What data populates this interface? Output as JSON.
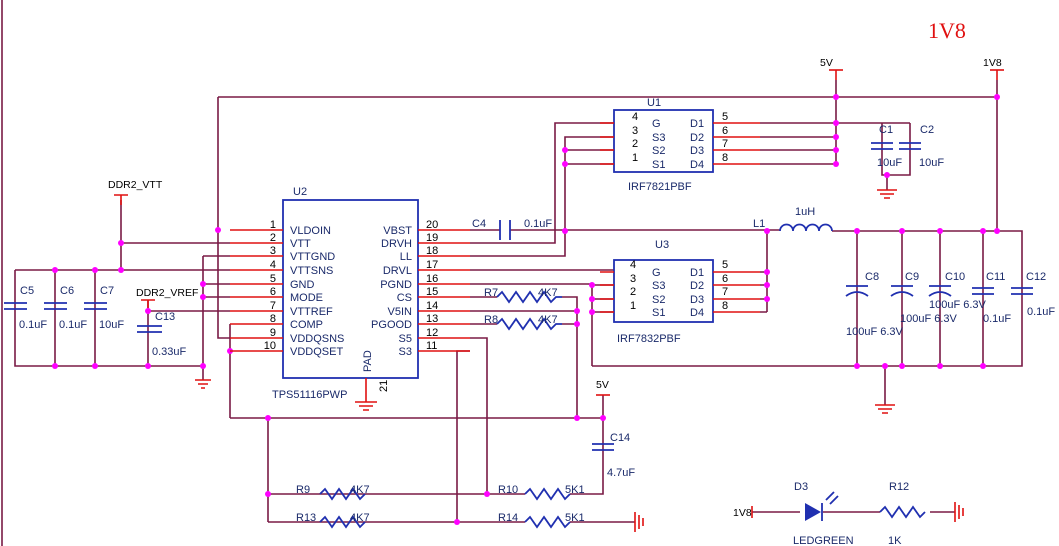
{
  "title": "1V8",
  "rails": {
    "v5": "5V",
    "v1v8": "1V8",
    "ddr2_vtt": "DDR2_VTT",
    "ddr2_vref": "DDR2_VREF"
  },
  "u2": {
    "ref": "U2",
    "part": "TPS51116PWP",
    "pad": "PAD",
    "pad_pin": "21",
    "left_pins": [
      {
        "num": "1",
        "name": "VLDOIN"
      },
      {
        "num": "2",
        "name": "VTT"
      },
      {
        "num": "3",
        "name": "VTTGND"
      },
      {
        "num": "4",
        "name": "VTTSNS"
      },
      {
        "num": "5",
        "name": "GND"
      },
      {
        "num": "6",
        "name": "MODE"
      },
      {
        "num": "7",
        "name": "VTTREF"
      },
      {
        "num": "8",
        "name": "COMP"
      },
      {
        "num": "9",
        "name": "VDDQSNS"
      },
      {
        "num": "10",
        "name": "VDDQSET"
      }
    ],
    "right_pins": [
      {
        "num": "20",
        "name": "VBST"
      },
      {
        "num": "19",
        "name": "DRVH"
      },
      {
        "num": "18",
        "name": "LL"
      },
      {
        "num": "17",
        "name": "DRVL"
      },
      {
        "num": "16",
        "name": "PGND"
      },
      {
        "num": "15",
        "name": "CS"
      },
      {
        "num": "14",
        "name": "V5IN"
      },
      {
        "num": "13",
        "name": "PGOOD"
      },
      {
        "num": "12",
        "name": "S5"
      },
      {
        "num": "11",
        "name": "S3"
      }
    ]
  },
  "u1": {
    "ref": "U1",
    "part": "IRF7821PBF",
    "left_pins": [
      {
        "num": "4",
        "name": "G"
      },
      {
        "num": "3",
        "name": "S3"
      },
      {
        "num": "2",
        "name": "S2"
      },
      {
        "num": "1",
        "name": "S1"
      }
    ],
    "right_pins": [
      {
        "num": "5",
        "name": "D1"
      },
      {
        "num": "6",
        "name": "D2"
      },
      {
        "num": "7",
        "name": "D3"
      },
      {
        "num": "8",
        "name": "D4"
      }
    ]
  },
  "u3": {
    "ref": "U3",
    "part": "IRF7832PBF",
    "left_pins": [
      {
        "num": "4",
        "name": "G"
      },
      {
        "num": "3",
        "name": "S3"
      },
      {
        "num": "2",
        "name": "S2"
      },
      {
        "num": "1",
        "name": "S1"
      }
    ],
    "right_pins": [
      {
        "num": "5",
        "name": "D1"
      },
      {
        "num": "6",
        "name": "D2"
      },
      {
        "num": "7",
        "name": "D3"
      },
      {
        "num": "8",
        "name": "D4"
      }
    ]
  },
  "caps": {
    "c1": {
      "ref": "C1",
      "value": "10uF"
    },
    "c2": {
      "ref": "C2",
      "value": "10uF"
    },
    "c4": {
      "ref": "C4",
      "value": "0.1uF"
    },
    "c5": {
      "ref": "C5",
      "value": "0.1uF"
    },
    "c6": {
      "ref": "C6",
      "value": "0.1uF"
    },
    "c7": {
      "ref": "C7",
      "value": "10uF"
    },
    "c8": {
      "ref": "C8",
      "value": "100uF 6.3V"
    },
    "c9": {
      "ref": "C9",
      "value": "100uF 6.3V"
    },
    "c10": {
      "ref": "C10",
      "value": "100uF 6.3V"
    },
    "c11": {
      "ref": "C11",
      "value": "0.1uF"
    },
    "c12": {
      "ref": "C12",
      "value": "0.1uF"
    },
    "c13": {
      "ref": "C13",
      "value": "0.33uF"
    },
    "c14": {
      "ref": "C14",
      "value": "4.7uF"
    }
  },
  "inductor": {
    "ref": "L1",
    "value": "1uH"
  },
  "resistors": {
    "r7": {
      "ref": "R7",
      "value": "4K7"
    },
    "r8": {
      "ref": "R8",
      "value": "4K7"
    },
    "r9": {
      "ref": "R9",
      "value": "4K7"
    },
    "r10": {
      "ref": "R10",
      "value": "5K1"
    },
    "r12": {
      "ref": "R12",
      "value": "1K"
    },
    "r13": {
      "ref": "R13",
      "value": "4K7"
    },
    "r14": {
      "ref": "R14",
      "value": "5K1"
    }
  },
  "led": {
    "ref": "D3",
    "part": "LEDGREEN"
  },
  "colors": {
    "wire": "#7a1a45",
    "pin": "#e01010",
    "component": "#2030b0",
    "junction": "#ff00ff",
    "title": "#e01010"
  }
}
